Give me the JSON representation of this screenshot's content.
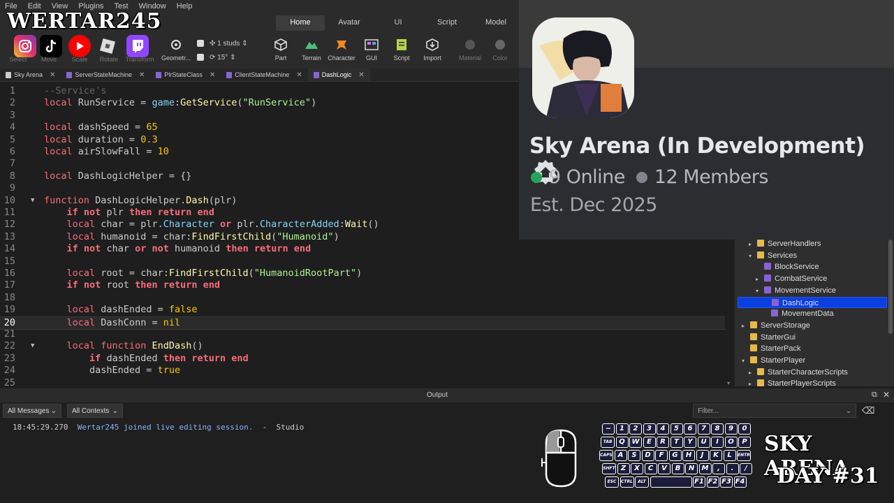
{
  "menu": [
    "File",
    "Edit",
    "View",
    "Plugins",
    "Test",
    "Window",
    "Help"
  ],
  "watermark": "WERTAR245",
  "ribbon_tabs": [
    {
      "label": "Home",
      "active": true
    },
    {
      "label": "Avatar",
      "active": false
    },
    {
      "label": "UI",
      "active": false
    },
    {
      "label": "Script",
      "active": false
    },
    {
      "label": "Model",
      "active": false
    }
  ],
  "tool_labels": {
    "select": "Select",
    "move": "Move",
    "scale": "Scale",
    "rotate": "Rotate",
    "transform": "Transform",
    "geometry": "Geometr...",
    "part": "Part",
    "terrain": "Terrain",
    "character": "Character",
    "gui": "GUI",
    "script": "Script",
    "import": "Import",
    "material": "Material",
    "color": "Color"
  },
  "snap": {
    "studs": "1 studs",
    "angle": "15°"
  },
  "file_tabs": [
    {
      "label": "Sky Arena",
      "active": false
    },
    {
      "label": "ServerStateMachine",
      "active": false
    },
    {
      "label": "PlrStateClass",
      "active": false
    },
    {
      "label": "ClientStateMachine",
      "active": false
    },
    {
      "label": "DashLogic",
      "active": true
    }
  ],
  "code_lines": [
    {
      "n": "1",
      "code": "<span class='cm'>--Service's</span>"
    },
    {
      "n": "2",
      "code": "<span class='lc'>local</span> <span class='pl'>RunService = </span><span class='bi'>game</span><span class='pl'>:</span><span class='fn'>GetService</span><span class='pl'>(</span><span class='st'>\"RunService\"</span><span class='pl'>)</span>"
    },
    {
      "n": "3",
      "code": ""
    },
    {
      "n": "4",
      "code": "<span class='lc'>local</span> <span class='pl'>dashSpeed = </span><span class='nm'>65</span>"
    },
    {
      "n": "5",
      "code": "<span class='lc'>local</span> <span class='pl'>duration = </span><span class='nm'>0.3</span>"
    },
    {
      "n": "6",
      "code": "<span class='lc'>local</span> <span class='pl'>airSlowFall = </span><span class='nm'>10</span>"
    },
    {
      "n": "7",
      "code": ""
    },
    {
      "n": "8",
      "code": "<span class='lc'>local</span> <span class='pl'>DashLogicHelper = {}</span>"
    },
    {
      "n": "9",
      "code": ""
    },
    {
      "n": "10",
      "code": "<span class='lc'>function</span> <span class='pl'>DashLogicHelper.</span><span class='fn'>Dash</span><span class='pl'>(plr)</span>",
      "fold": true
    },
    {
      "n": "11",
      "code": "    <span class='kw'>if not</span> <span class='pl'>plr</span> <span class='kw'>then return end</span>"
    },
    {
      "n": "12",
      "code": "    <span class='lc'>local</span> <span class='pl'>char = plr.</span><span class='bi'>Character</span> <span class='kw'>or</span> <span class='pl'>plr.</span><span class='bi'>CharacterAdded</span><span class='pl'>:</span><span class='fn'>Wait</span><span class='pl'>()</span>"
    },
    {
      "n": "13",
      "code": "    <span class='lc'>local</span> <span class='pl'>humanoid = char:</span><span class='fn'>FindFirstChild</span><span class='pl'>(</span><span class='st'>\"Humanoid\"</span><span class='pl'>)</span>"
    },
    {
      "n": "14",
      "code": "    <span class='kw'>if not</span> <span class='pl'>char</span> <span class='kw'>or not</span> <span class='pl'>humanoid</span> <span class='kw'>then return end</span>"
    },
    {
      "n": "15",
      "code": ""
    },
    {
      "n": "16",
      "code": "    <span class='lc'>local</span> <span class='pl'>root = char:</span><span class='fn'>FindFirstChild</span><span class='pl'>(</span><span class='st'>\"HumanoidRootPart\"</span><span class='pl'>)</span>"
    },
    {
      "n": "17",
      "code": "    <span class='kw'>if not</span> <span class='pl'>root</span> <span class='kw'>then return end</span>"
    },
    {
      "n": "18",
      "code": ""
    },
    {
      "n": "19",
      "code": "    <span class='lc'>local</span> <span class='pl'>dashEnded = </span><span class='nm'>false</span>"
    },
    {
      "n": "20",
      "code": "    <span class='lc'>local</span> <span class='pl'>DashConn = </span><span class='nm'>nil</span>",
      "current": true
    },
    {
      "n": "21",
      "code": ""
    },
    {
      "n": "22",
      "code": "    <span class='lc'>local</span> <span class='lc'>function</span> <span class='fn'>EndDash</span><span class='pl'>()</span>",
      "fold": true
    },
    {
      "n": "23",
      "code": "        <span class='kw'>if</span> <span class='pl'>dashEnded</span> <span class='kw'>then return end</span>"
    },
    {
      "n": "24",
      "code": "        <span class='pl'>dashEnded = </span><span class='nm'>true</span>"
    },
    {
      "n": "25",
      "code": ""
    }
  ],
  "card": {
    "title": "Sky Arena (In Development)",
    "online": "9 Online",
    "members": "12 Members",
    "established": "Est. Dec 2025",
    "online_color": "#23a55a",
    "members_color": "#80848e"
  },
  "explorer": [
    {
      "label": "ServerHandlers",
      "icon": "folder",
      "arrow": "▸",
      "indent": 1
    },
    {
      "label": "Services",
      "icon": "folder",
      "arrow": "▾",
      "indent": 1
    },
    {
      "label": "BlockService",
      "icon": "svc",
      "arrow": "",
      "indent": 2
    },
    {
      "label": "CombatService",
      "icon": "svc",
      "arrow": "▸",
      "indent": 2
    },
    {
      "label": "MovementService",
      "icon": "svc",
      "arrow": "▾",
      "indent": 2
    },
    {
      "label": "DashLogic",
      "icon": "svc",
      "arrow": "",
      "indent": 3,
      "selected": true
    },
    {
      "label": "MovementData",
      "icon": "svc",
      "arrow": "",
      "indent": 3
    },
    {
      "label": "ServerStorage",
      "icon": "folder",
      "arrow": "▸",
      "indent": 0
    },
    {
      "label": "StarterGui",
      "icon": "folder",
      "arrow": "",
      "indent": 0
    },
    {
      "label": "StarterPack",
      "icon": "folder",
      "arrow": "",
      "indent": 0
    },
    {
      "label": "StarterPlayer",
      "icon": "folder",
      "arrow": "▾",
      "indent": 0
    },
    {
      "label": "StarterCharacterScripts",
      "icon": "folder",
      "arrow": "▸",
      "indent": 1
    },
    {
      "label": "StarterPlayerScripts",
      "icon": "folder",
      "arrow": "▸",
      "indent": 1
    }
  ],
  "output": {
    "title": "Output",
    "messages_filter": "All Messages",
    "contexts_filter": "All Contexts",
    "filter_placeholder": "Filter...",
    "time": "18:45:29.270",
    "message": "Wertar245 joined live editing session.",
    "separator": "-",
    "source": "Studio"
  },
  "overlay": {
    "line1": "SKY ARENA",
    "line2": "DAY #31"
  },
  "keyboard_rows": [
    [
      "~",
      "1",
      "2",
      "3",
      "4",
      "5",
      "6",
      "7",
      "8",
      "9",
      "0"
    ],
    [
      "TAB",
      "Q",
      "W",
      "E",
      "R",
      "T",
      "Y",
      "U",
      "I",
      "O",
      "P"
    ],
    [
      "CAPS",
      "A",
      "S",
      "D",
      "F",
      "G",
      "H",
      "J",
      "K",
      "L",
      "ENTR"
    ],
    [
      "SHFT",
      "Z",
      "X",
      "C",
      "V",
      "B",
      "N",
      "M",
      ",",
      ".",
      "/"
    ],
    [
      "ESC",
      "CTRL",
      "ALT",
      "",
      "F1",
      "F2",
      "F3",
      "F4"
    ]
  ]
}
